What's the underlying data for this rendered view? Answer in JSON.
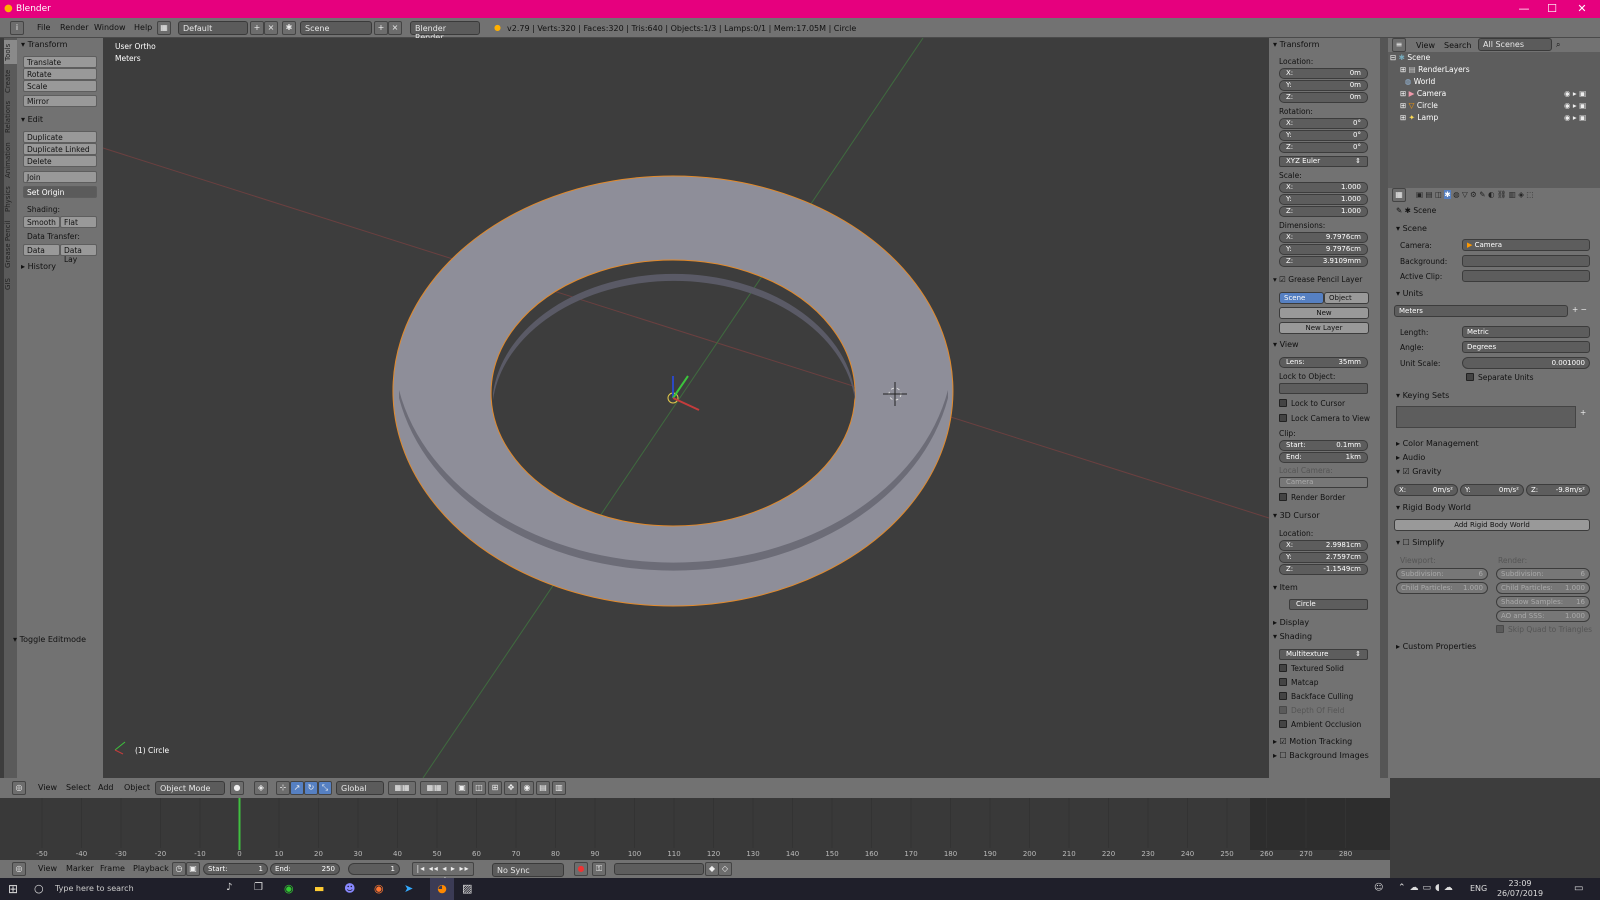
{
  "window": {
    "title": "Blender"
  },
  "infobar": {
    "menus": [
      "File",
      "Render",
      "Window",
      "Help"
    ],
    "layout": "Default",
    "scene": "Scene",
    "engine": "Blender Render",
    "stats": "v2.79 | Verts:320 | Faces:320 | Tris:640 | Objects:1/3 | Lamps:0/1 | Mem:17.05M | Circle"
  },
  "tabs": [
    "Tools",
    "Create",
    "Relations",
    "Animation",
    "Physics",
    "Grease Pencil",
    "GIS"
  ],
  "tools": {
    "transform": "Transform",
    "translate": "Translate",
    "rotate": "Rotate",
    "scale": "Scale",
    "mirror": "Mirror",
    "edit": "Edit",
    "duplicate": "Duplicate",
    "duplicate_linked": "Duplicate Linked",
    "delete": "Delete",
    "join": "Join",
    "set_origin": "Set Origin",
    "shading": "Shading:",
    "smooth": "Smooth",
    "flat": "Flat",
    "data_transfer": "Data Transfer:",
    "data": "Data",
    "data_lay": "Data Lay",
    "history": "History",
    "toggle_editmode": "Toggle Editmode"
  },
  "viewport": {
    "view_label": "User Ortho",
    "units": "Meters",
    "object_label": "(1) Circle"
  },
  "props": {
    "transform": "Transform",
    "location": "Location:",
    "loc": {
      "x": "0m",
      "y": "0m",
      "z": "0m"
    },
    "rotation": "Rotation:",
    "rot": {
      "x": "0°",
      "y": "0°",
      "z": "0°"
    },
    "rot_mode": "XYZ Euler",
    "scale": "Scale:",
    "scl": {
      "x": "1.000",
      "y": "1.000",
      "z": "1.000"
    },
    "dimensions": "Dimensions:",
    "dim": {
      "x": "9.7976cm",
      "y": "9.7976cm",
      "z": "3.9109mm"
    },
    "grease": "Grease Pencil Layer",
    "gp_scene": "Scene",
    "gp_object": "Object",
    "gp_new": "New",
    "gp_new_layer": "New Layer",
    "view": "View",
    "lens": "Lens:",
    "lens_val": "35mm",
    "lock_obj": "Lock to Object:",
    "lock_cursor": "Lock to Cursor",
    "lock_cam": "Lock Camera to View",
    "clip": "Clip:",
    "clip_start": "Start:",
    "clip_start_val": "0.1mm",
    "clip_end": "End:",
    "clip_end_val": "1km",
    "local_camera": "Local Camera:",
    "local_camera_val": "Camera",
    "render_border": "Render Border",
    "cursor": "3D Cursor",
    "cursor_loc": "Location:",
    "cur": {
      "x": "2.9981cm",
      "y": "2.7597cm",
      "z": "-1.1549cm"
    },
    "item": "Item",
    "item_name": "Circle",
    "display": "Display",
    "shading": "Shading",
    "shading_mode": "Multitexture",
    "textured": "Textured Solid",
    "matcap": "Matcap",
    "backface": "Backface Culling",
    "dof": "Depth Of Field",
    "ao": "Ambient Occlusion",
    "motion": "Motion Tracking",
    "bgimg": "Background Images"
  },
  "outliner": {
    "view": "View",
    "search": "Search",
    "scenes": "All Scenes",
    "items": [
      "Scene",
      "RenderLayers",
      "World",
      "Camera",
      "Circle",
      "Lamp"
    ]
  },
  "scene_props": {
    "breadcrumb": "Scene",
    "scene": "Scene",
    "camera": "Camera:",
    "camera_val": "Camera",
    "background": "Background:",
    "active_clip": "Active Clip:",
    "units": "Units",
    "units_preset": "Meters",
    "length": "Length:",
    "length_val": "Metric",
    "angle": "Angle:",
    "angle_val": "Degrees",
    "unit_scale": "Unit Scale:",
    "unit_scale_val": "0.001000",
    "separate": "Separate Units",
    "keying": "Keying Sets",
    "color_mgmt": "Color Management",
    "audio": "Audio",
    "gravity": "Gravity",
    "grav": {
      "x": "0m/s²",
      "y": "0m/s²",
      "z": "-9.8m/s²"
    },
    "rigid": "Rigid Body World",
    "add_rigid": "Add Rigid Body World",
    "simplify": "Simplify",
    "viewport": "Viewport:",
    "render": "Render:",
    "subdivision": "Subdivision:",
    "sub_vp": "6",
    "sub_r": "6",
    "child_particles": "Child Particles:",
    "cp_vp": "1.000",
    "cp_r": "1.000",
    "shadow_samples": "Shadow Samples:",
    "ss_val": "16",
    "ao_sss": "AO and SSS:",
    "ao_val": "1.000",
    "skip_quad": "Skip Quad to Triangles",
    "custom": "Custom Properties"
  },
  "vp_header": {
    "view": "View",
    "select": "Select",
    "add": "Add",
    "object": "Object",
    "mode": "Object Mode",
    "orientation": "Global"
  },
  "timeline": {
    "ticks": [
      "-50",
      "-40",
      "-30",
      "-20",
      "-10",
      "0",
      "10",
      "20",
      "30",
      "40",
      "50",
      "60",
      "70",
      "80",
      "90",
      "100",
      "110",
      "120",
      "130",
      "140",
      "150",
      "160",
      "170",
      "180",
      "190",
      "200",
      "210",
      "220",
      "230",
      "240",
      "250",
      "260",
      "270",
      "280"
    ],
    "current_frame": 0
  },
  "tl_header": {
    "view": "View",
    "marker": "Marker",
    "frame": "Frame",
    "playback": "Playback",
    "start": "Start:",
    "start_val": "1",
    "end": "End:",
    "end_val": "250",
    "frame_val": "1",
    "sync": "No Sync"
  },
  "taskbar": {
    "search": "Type here to search",
    "time": "23:09",
    "date": "26/07/2019",
    "lang": "ENG"
  },
  "colors": {
    "titlebar": "#e6007e",
    "panel": "#727272",
    "viewport": "#3d3d3d",
    "mesh": "#8e8e99",
    "selection_outline": "#e28a2b"
  }
}
